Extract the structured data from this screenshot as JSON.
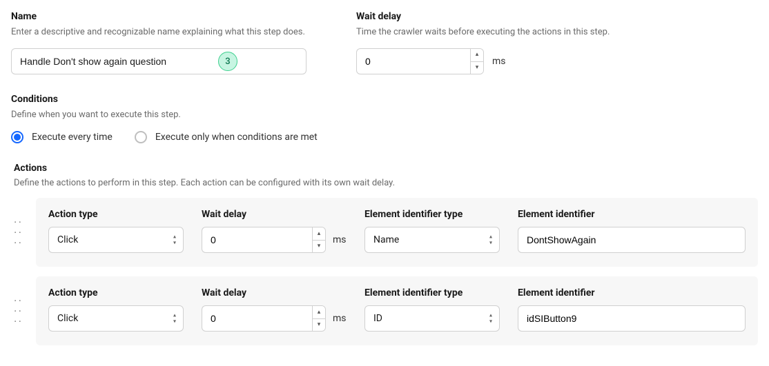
{
  "name": {
    "label": "Name",
    "help": "Enter a descriptive and recognizable name explaining what this step does.",
    "value": "Handle Don't show again question",
    "badge": "3"
  },
  "waitDelay": {
    "label": "Wait delay",
    "help": "Time the crawler waits before executing the actions in this step.",
    "value": "0",
    "unit": "ms"
  },
  "conditions": {
    "label": "Conditions",
    "help": "Define when you want to execute this step.",
    "options": [
      {
        "label": "Execute every time",
        "selected": true
      },
      {
        "label": "Execute only when conditions are met",
        "selected": false
      }
    ]
  },
  "actions": {
    "label": "Actions",
    "help": "Define the actions to perform in this step. Each action can be configured with its own wait delay.",
    "columns": {
      "actionType": "Action type",
      "waitDelay": "Wait delay",
      "idType": "Element identifier type",
      "id": "Element identifier"
    },
    "unit": "ms",
    "rows": [
      {
        "actionType": "Click",
        "waitDelay": "0",
        "idType": "Name",
        "id": "DontShowAgain"
      },
      {
        "actionType": "Click",
        "waitDelay": "0",
        "idType": "ID",
        "id": "idSIButton9"
      }
    ]
  }
}
